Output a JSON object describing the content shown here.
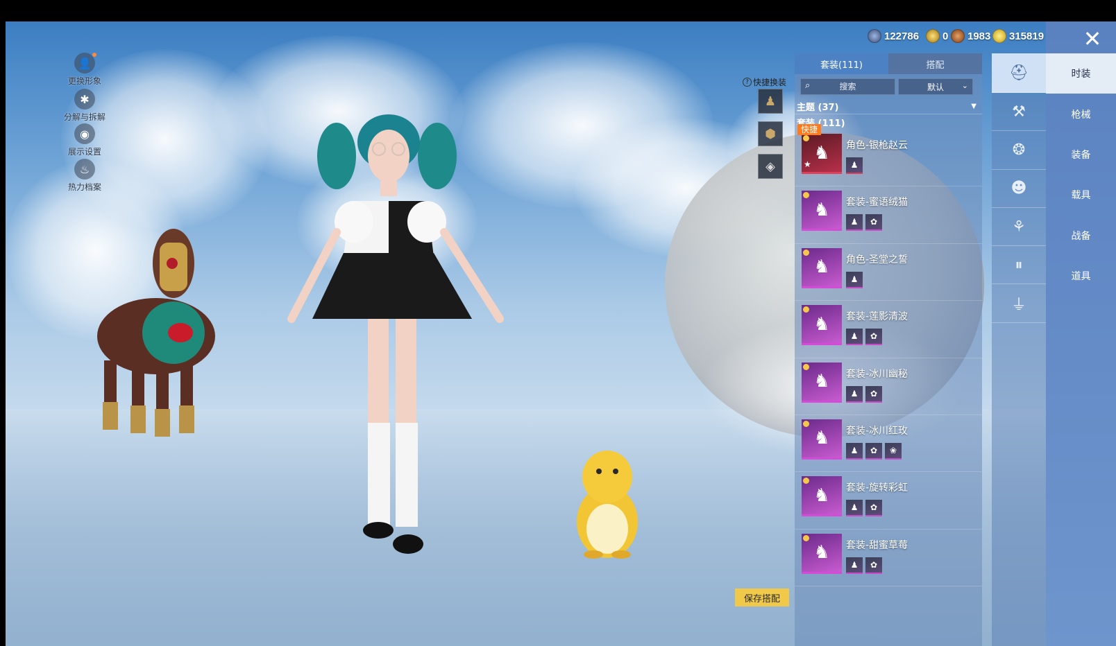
{
  "currency": [
    {
      "icon": "globe-coin-icon",
      "value": "122786"
    },
    {
      "icon": "gold-badge-icon",
      "value": "0"
    },
    {
      "icon": "bronze-coin-icon",
      "value": "1983"
    },
    {
      "icon": "gold-coin-icon",
      "value": "315819"
    }
  ],
  "side_menu": [
    {
      "label": "更换形象",
      "icon": "avatar-icon"
    },
    {
      "label": "分解与拆解",
      "icon": "decompose-icon"
    },
    {
      "label": "展示设置",
      "icon": "eye-icon"
    },
    {
      "label": "热力档案",
      "icon": "flame-icon"
    }
  ],
  "quick_change": {
    "label": "快捷换装"
  },
  "panel": {
    "tabs": [
      "套装(111)",
      "搭配"
    ],
    "search_placeholder": "搜索",
    "sort_label": "默认",
    "theme_label": "主题 (37)",
    "section_title": "套装 (111)",
    "items": [
      {
        "name": "角色-银枪赵云",
        "badge": "快捷",
        "rarity": "red",
        "subs": 1
      },
      {
        "name": "套装-蜜语绒猫",
        "badge": "",
        "rarity": "purple",
        "subs": 2
      },
      {
        "name": "角色-圣堂之誓",
        "badge": "",
        "rarity": "purple",
        "subs": 1
      },
      {
        "name": "套装-莲影清波",
        "badge": "",
        "rarity": "purple",
        "subs": 2
      },
      {
        "name": "套装-冰川幽秘",
        "badge": "",
        "rarity": "purple",
        "subs": 2
      },
      {
        "name": "套装-冰川红玫",
        "badge": "",
        "rarity": "purple",
        "subs": 3
      },
      {
        "name": "套装-旋转彩虹",
        "badge": "",
        "rarity": "purple",
        "subs": 2
      },
      {
        "name": "套装-甜蜜草莓",
        "badge": "",
        "rarity": "purple",
        "subs": 2
      }
    ]
  },
  "categories": [
    "hat-icon",
    "gun-icon",
    "chain-icon",
    "mask-icon",
    "outfit-icon",
    "pants-icon",
    "shoes-icon"
  ],
  "main_tabs": [
    "时装",
    "枪械",
    "装备",
    "载具",
    "战备",
    "道具"
  ],
  "save_button": "保存搭配"
}
